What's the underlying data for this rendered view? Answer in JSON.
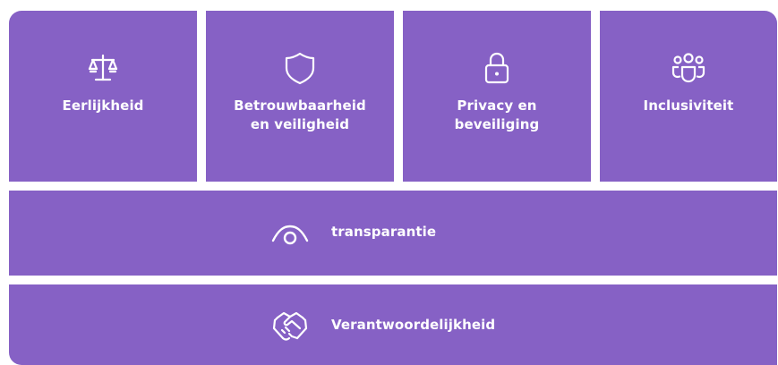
{
  "colors": {
    "tile_background": "#8661c5",
    "text": "#ffffff"
  },
  "principles": [
    {
      "label": "Eerlijkheid",
      "icon": "scales-icon"
    },
    {
      "label": "Betrouwbaarheid\nen veiligheid",
      "icon": "shield-icon"
    },
    {
      "label": "Privacy en\nbeveiliging",
      "icon": "lock-icon"
    },
    {
      "label": "Inclusiviteit",
      "icon": "people-group-icon"
    }
  ],
  "transparency": {
    "label": "transparantie",
    "icon": "eye-icon"
  },
  "accountability": {
    "label": "Verantwoordelijkheid",
    "icon": "handshake-icon"
  }
}
